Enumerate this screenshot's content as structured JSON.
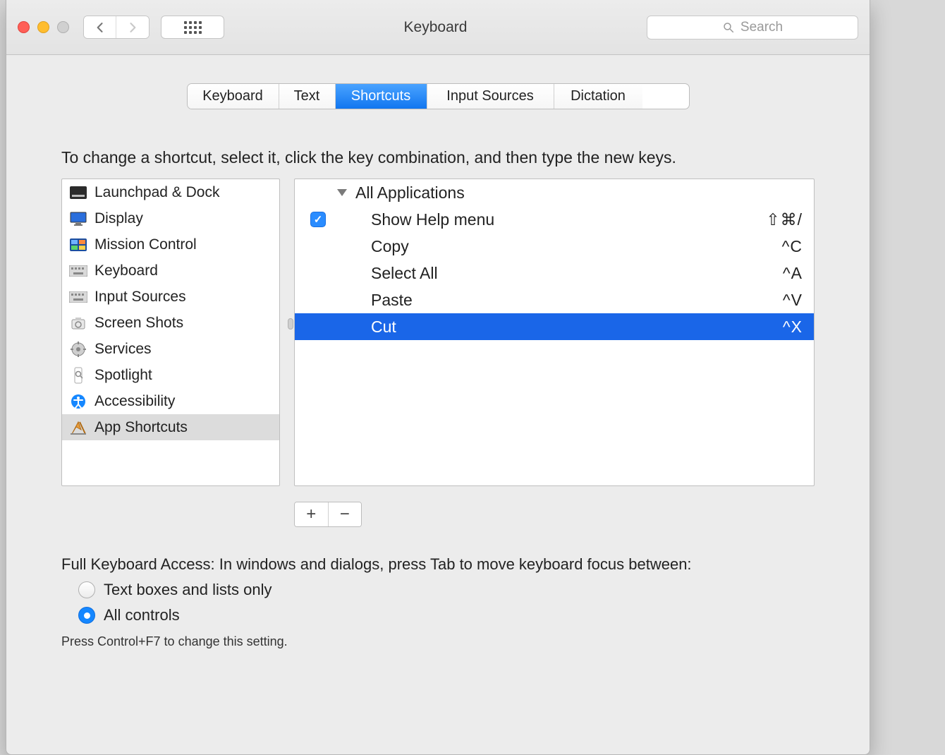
{
  "window": {
    "title": "Keyboard"
  },
  "search": {
    "placeholder": "Search"
  },
  "tabs": [
    {
      "label": "Keyboard"
    },
    {
      "label": "Text"
    },
    {
      "label": "Shortcuts"
    },
    {
      "label": "Input Sources"
    },
    {
      "label": "Dictation"
    }
  ],
  "instructions": "To change a shortcut, select it, click the key combination, and then type the new keys.",
  "categories": [
    {
      "label": "Launchpad & Dock"
    },
    {
      "label": "Display"
    },
    {
      "label": "Mission Control"
    },
    {
      "label": "Keyboard"
    },
    {
      "label": "Input Sources"
    },
    {
      "label": "Screen Shots"
    },
    {
      "label": "Services"
    },
    {
      "label": "Spotlight"
    },
    {
      "label": "Accessibility"
    },
    {
      "label": "App Shortcuts"
    }
  ],
  "group": {
    "title": "All Applications"
  },
  "shortcuts": [
    {
      "label": "Show Help menu",
      "keys": "⇧⌘/"
    },
    {
      "label": "Copy",
      "keys": "^C"
    },
    {
      "label": "Select All",
      "keys": "^A"
    },
    {
      "label": "Paste",
      "keys": "^V"
    },
    {
      "label": "Cut",
      "keys": "^X"
    }
  ],
  "footer": {
    "heading": "Full Keyboard Access: In windows and dialogs, press Tab to move keyboard focus between:",
    "opt_text_only": "Text boxes and lists only",
    "opt_all": "All controls",
    "hint": "Press Control+F7 to change this setting."
  },
  "buttons": {
    "add": "+",
    "remove": "−"
  }
}
